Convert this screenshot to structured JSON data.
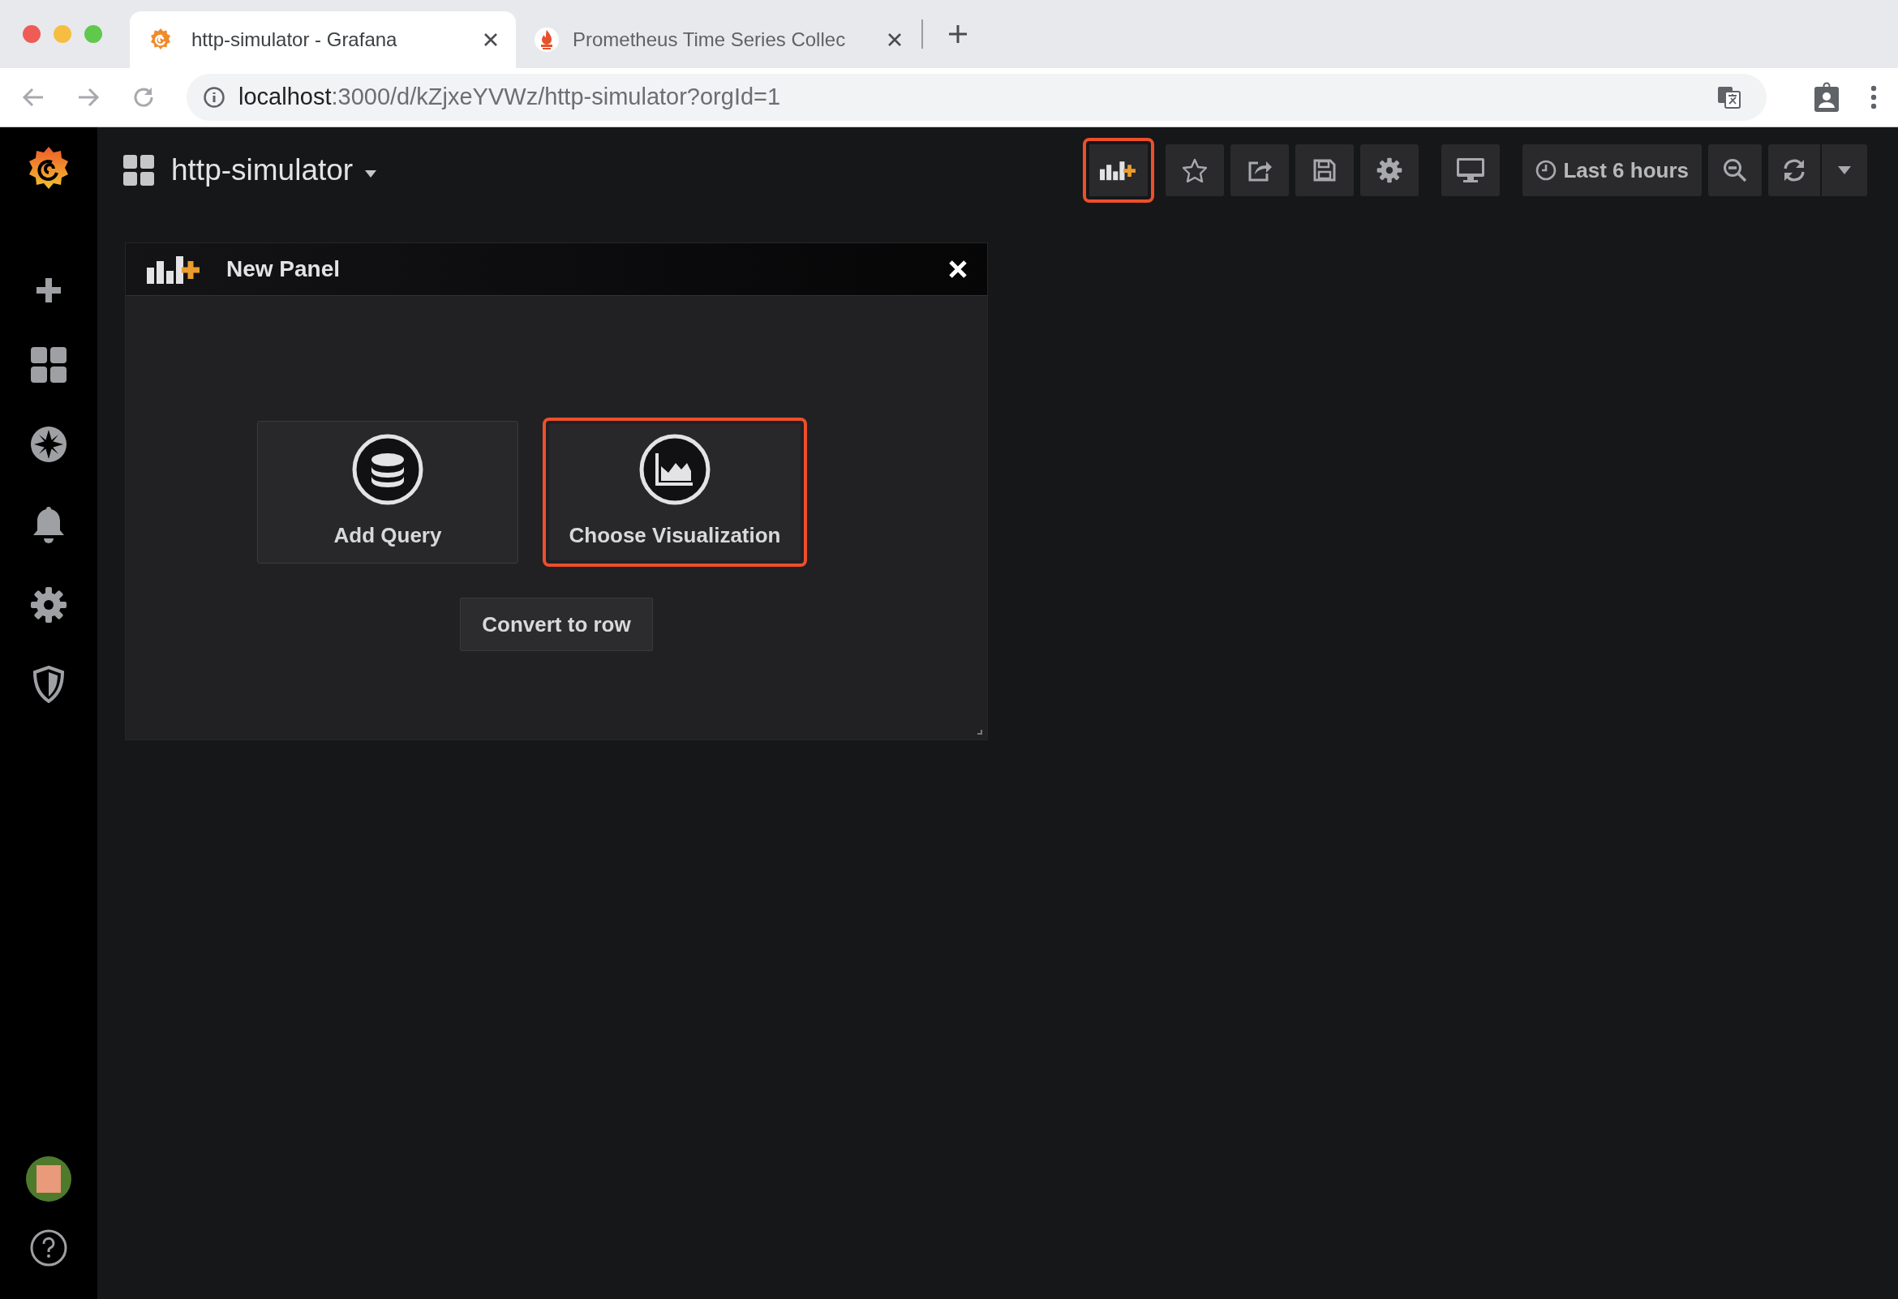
{
  "browser": {
    "tabs": [
      {
        "title": "http-simulator - Grafana",
        "selected": true,
        "kind": "grafana"
      },
      {
        "title": "Prometheus Time Series Collec",
        "selected": false,
        "kind": "prometheus"
      }
    ],
    "url": {
      "host": "localhost",
      "path": ":3000/d/kZjxeYVWz/http-simulator?orgId=1"
    }
  },
  "dashboard": {
    "title": "http-simulator"
  },
  "toolbar": {
    "buttons": [
      {
        "kind": "add-panel",
        "highlighted": true
      },
      {
        "kind": "star",
        "highlighted": false
      },
      {
        "kind": "share",
        "highlighted": false
      },
      {
        "kind": "save",
        "highlighted": false
      },
      {
        "kind": "settings",
        "highlighted": false
      },
      {
        "kind": "tv",
        "highlighted": false
      }
    ],
    "time_range": "Last 6 hours"
  },
  "panel": {
    "title": "New Panel",
    "actions": [
      {
        "label": "Add Query",
        "kind": "query",
        "highlighted": false
      },
      {
        "label": "Choose Visualization",
        "kind": "visualization",
        "highlighted": true
      }
    ],
    "convert_button": "Convert to row"
  }
}
